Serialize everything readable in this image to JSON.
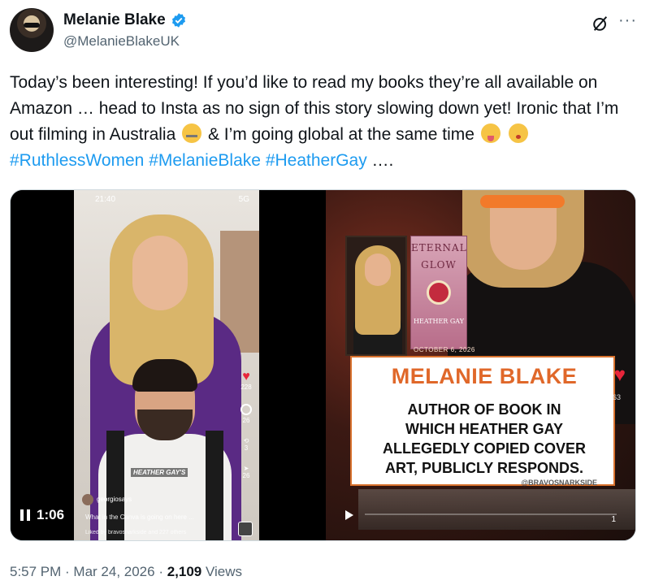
{
  "author": {
    "display_name": "Melanie Blake",
    "handle": "@MelanieBlakeUK",
    "verified": true
  },
  "tweet": {
    "text_1": "Today’s been interesting! If you’d like to read my books they’re all available on Amazon … head to Insta as no sign of this story slowing down yet! Ironic that I’m out filming in Australia",
    "text_2": " & I’m going global at the same time ",
    "hashtags": [
      "#RuthlessWomen",
      "#MelanieBlake",
      "#HeatherGay"
    ],
    "ellipsis": " …."
  },
  "media_left": {
    "status_time": "21:40",
    "status_signal": "5G",
    "caption_tag": "HEATHER GAY'S",
    "side_counts": [
      "228",
      "26",
      "3",
      "26"
    ],
    "username": "georgiosays",
    "comment": "What in the Canva is going on here ...",
    "liked_by": "Liked by bravosnarkside and 227 others",
    "timestamp": "1:06"
  },
  "media_right": {
    "book_title_1": "ETERNAL",
    "book_title_2": "GLOW",
    "book_author": "HEATHER GAY",
    "date": "OCTOBER 6, 2026",
    "banner_name": "MELANIE BLAKE",
    "banner_line_1": "AUTHOR OF BOOK IN",
    "banner_line_2": "WHICH HEATHER GAY",
    "banner_line_3": "ALLEGEDLY COPIED COVER",
    "banner_line_4": "ART, PUBLICLY RESPONDS.",
    "credit": "@BRAVOSNARKSIDE",
    "count_top": "63",
    "count_bottom": "1"
  },
  "footer": {
    "time": "5:57 PM",
    "date": "Mar 24, 2026",
    "views": "2,109",
    "views_label": "Views"
  },
  "colors": {
    "link": "#1d9bf0",
    "verified": "#1d9bf0",
    "banner_orange": "#e0682a"
  },
  "icons": [
    "verified-badge-icon",
    "grok-icon",
    "more-icon",
    "pause-icon",
    "play-icon",
    "heart-icon"
  ]
}
